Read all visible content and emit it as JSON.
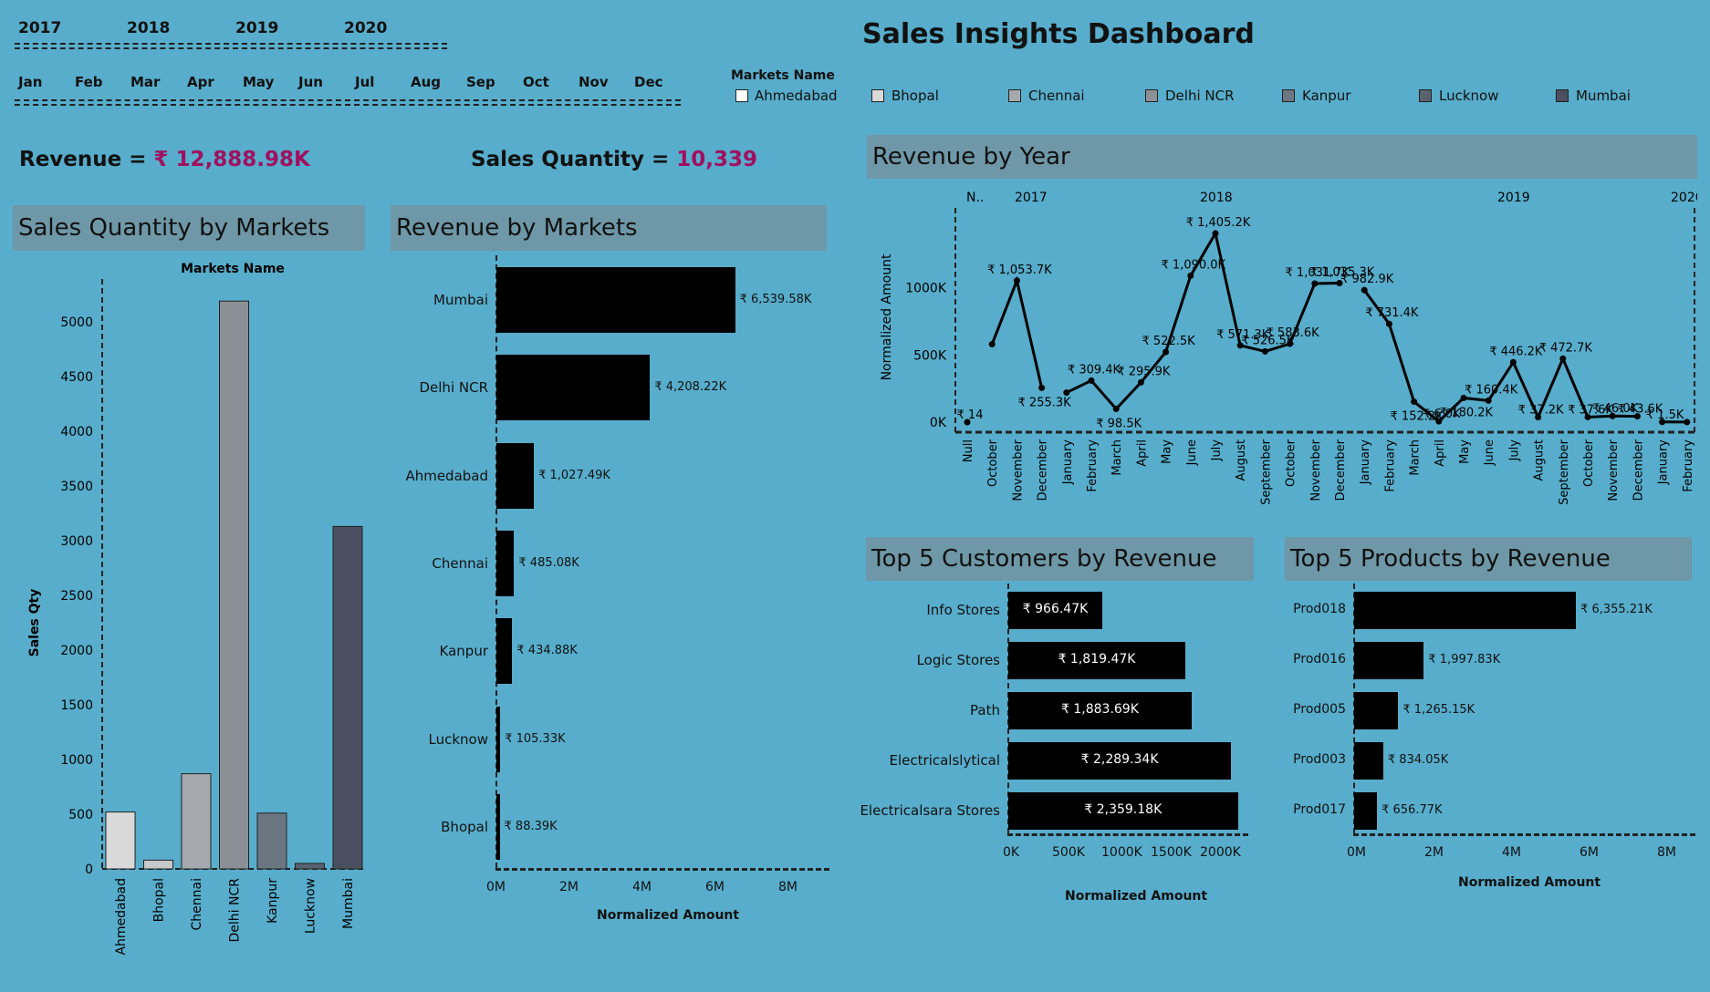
{
  "filters": {
    "years": [
      "2017",
      "2018",
      "2019",
      "2020"
    ],
    "months": [
      "Jan",
      "Feb",
      "Mar",
      "Apr",
      "May",
      "Jun",
      "Jul",
      "Aug",
      "Sep",
      "Oct",
      "Nov",
      "Dec"
    ],
    "markets_title": "Markets Name",
    "markets_option": "Ahmedabad"
  },
  "dashboard_title": "Sales Insights Dashboard",
  "legend": [
    {
      "name": "Bhopal",
      "color": "#d9d9d9"
    },
    {
      "name": "Chennai",
      "color": "#a6a9ad"
    },
    {
      "name": "Delhi NCR",
      "color": "#8b8f96"
    },
    {
      "name": "Kanpur",
      "color": "#6c7680"
    },
    {
      "name": "Lucknow",
      "color": "#5a6270"
    },
    {
      "name": "Mumbai",
      "color": "#4b5060"
    }
  ],
  "kpis": {
    "revenue_label": "Revenue = ",
    "revenue_value": "₹ 12,888.98K",
    "qty_label": "Sales Quantity = ",
    "qty_value": "10,339"
  },
  "sales_qty_panel": {
    "title": "Sales Quantity by Markets",
    "chart_data": {
      "type": "bar",
      "title": "Markets Name",
      "ylabel": "Sales Qty",
      "categories": [
        "Ahmedabad",
        "Bhopal",
        "Chennai",
        "Delhi NCR",
        "Kanpur",
        "Lucknow",
        "Mumbai"
      ],
      "values": [
        520,
        80,
        870,
        5190,
        510,
        50,
        3130
      ],
      "colors": [
        "#d9d9d9",
        "#c7c8ca",
        "#a6a9ad",
        "#8b8f96",
        "#6c7680",
        "#5a6270",
        "#4b5060"
      ],
      "yticks": [
        0,
        500,
        1000,
        1500,
        2000,
        2500,
        3000,
        3500,
        4000,
        4500,
        5000
      ],
      "ylim": [
        0,
        5500
      ]
    }
  },
  "revenue_markets_panel": {
    "title": "Revenue by Markets",
    "chart_data": {
      "type": "bar",
      "orientation": "horizontal",
      "xlabel": "Normalized Amount",
      "categories": [
        "Mumbai",
        "Delhi NCR",
        "Ahmedabad",
        "Chennai",
        "Kanpur",
        "Lucknow",
        "Bhopal"
      ],
      "values": [
        6539.58,
        4208.22,
        1027.49,
        485.08,
        434.88,
        105.33,
        88.39
      ],
      "labels": [
        "₹ 6,539.58K",
        "₹ 4,208.22K",
        "₹ 1,027.49K",
        "₹ 485.08K",
        "₹ 434.88K",
        "₹ 105.33K",
        "₹ 88.39K"
      ],
      "xticks": [
        "0M",
        "2M",
        "4M",
        "6M",
        "8M"
      ],
      "xlim": [
        0,
        8000
      ]
    }
  },
  "revenue_year_panel": {
    "title": "Revenue by Year",
    "chart_data": {
      "type": "line",
      "ylabel": "Normalized Amount",
      "yticks": [
        "0K",
        "500K",
        "1000K"
      ],
      "ylim": [
        0,
        1500
      ],
      "year_headers": [
        "N..",
        "2017",
        "2018",
        "2019",
        "2020"
      ],
      "segments": [
        {
          "year": "N..",
          "months": [
            "Null"
          ],
          "values": [
            0.014
          ],
          "labels": [
            "₹ 14"
          ]
        },
        {
          "year": "2017",
          "months": [
            "October",
            "November",
            "December"
          ],
          "values": [
            580,
            1053.7,
            255.3
          ],
          "labels": [
            "",
            "₹ 1,053.7K",
            "₹ 255.3K"
          ]
        },
        {
          "year": "2018",
          "months": [
            "January",
            "February",
            "March",
            "April",
            "May",
            "June",
            "July",
            "August",
            "September",
            "October",
            "November",
            "December"
          ],
          "values": [
            220,
            309.4,
            98.5,
            295.9,
            522.5,
            1090.0,
            1405.2,
            571.3,
            526.5,
            583.6,
            1031.7,
            1035.3
          ],
          "labels": [
            "",
            "₹ 309.4K",
            "₹ 98.5K",
            "₹ 295.9K",
            "₹ 522.5K",
            "₹ 1,090.0K",
            "₹ 1,405.2K",
            "₹ 571.3K",
            "₹ 526.5K",
            "₹ 583.6K",
            "₹ 1,031.7K",
            "₹ 1,035.3K"
          ]
        },
        {
          "year": "2019",
          "months": [
            "January",
            "February",
            "March",
            "April",
            "May",
            "June",
            "July",
            "August",
            "September",
            "October",
            "November",
            "December"
          ],
          "values": [
            982.9,
            731.4,
            152.2,
            6.0,
            180.2,
            160.4,
            446.2,
            37.2,
            472.7,
            37.6,
            46.0,
            43.6
          ],
          "labels": [
            "₹ 982.9K",
            "₹ 731.4K",
            "₹ 152.2K",
            "₹ 6.0K",
            "₹ 180.2K",
            "₹ 160.4K",
            "₹ 446.2K",
            "₹ 37.2K",
            "₹ 472.7K",
            "₹ 37.6K",
            "₹ 46.0K",
            "₹ 43.6K"
          ]
        },
        {
          "year": "2020",
          "months": [
            "January",
            "February"
          ],
          "values": [
            1.5,
            0.5
          ],
          "labels": [
            "₹ 1.5K",
            ""
          ]
        }
      ]
    }
  },
  "customers_panel": {
    "title": "Top 5 Customers by Revenue",
    "chart_data": {
      "type": "bar",
      "orientation": "horizontal",
      "xlabel": "Normalized Amount",
      "categories": [
        "Info Stores",
        "Logic Stores",
        "Path",
        "Electricalslytical",
        "Electricalsara Stores"
      ],
      "values": [
        966.47,
        1819.47,
        1883.69,
        2289.34,
        2359.18
      ],
      "labels": [
        "₹ 966.47K",
        "₹ 1,819.47K",
        "₹ 1,883.69K",
        "₹ 2,289.34K",
        "₹ 2,359.18K"
      ],
      "xticks": [
        "0K",
        "500K",
        "1000K",
        "1500K",
        "2000K"
      ],
      "xlim": [
        0,
        2400
      ]
    }
  },
  "products_panel": {
    "title": "Top 5 Products by Revenue",
    "chart_data": {
      "type": "bar",
      "orientation": "horizontal",
      "xlabel": "Normalized Amount",
      "categories": [
        "Prod018",
        "Prod016",
        "Prod005",
        "Prod003",
        "Prod017"
      ],
      "values": [
        6355.21,
        1997.83,
        1265.15,
        834.05,
        656.77
      ],
      "labels": [
        "₹ 6,355.21K",
        "₹ 1,997.83K",
        "₹ 1,265.15K",
        "₹ 834.05K",
        "₹ 656.77K"
      ],
      "xticks": [
        "0M",
        "2M",
        "4M",
        "6M",
        "8M"
      ],
      "xlim": [
        0,
        8000
      ]
    }
  }
}
